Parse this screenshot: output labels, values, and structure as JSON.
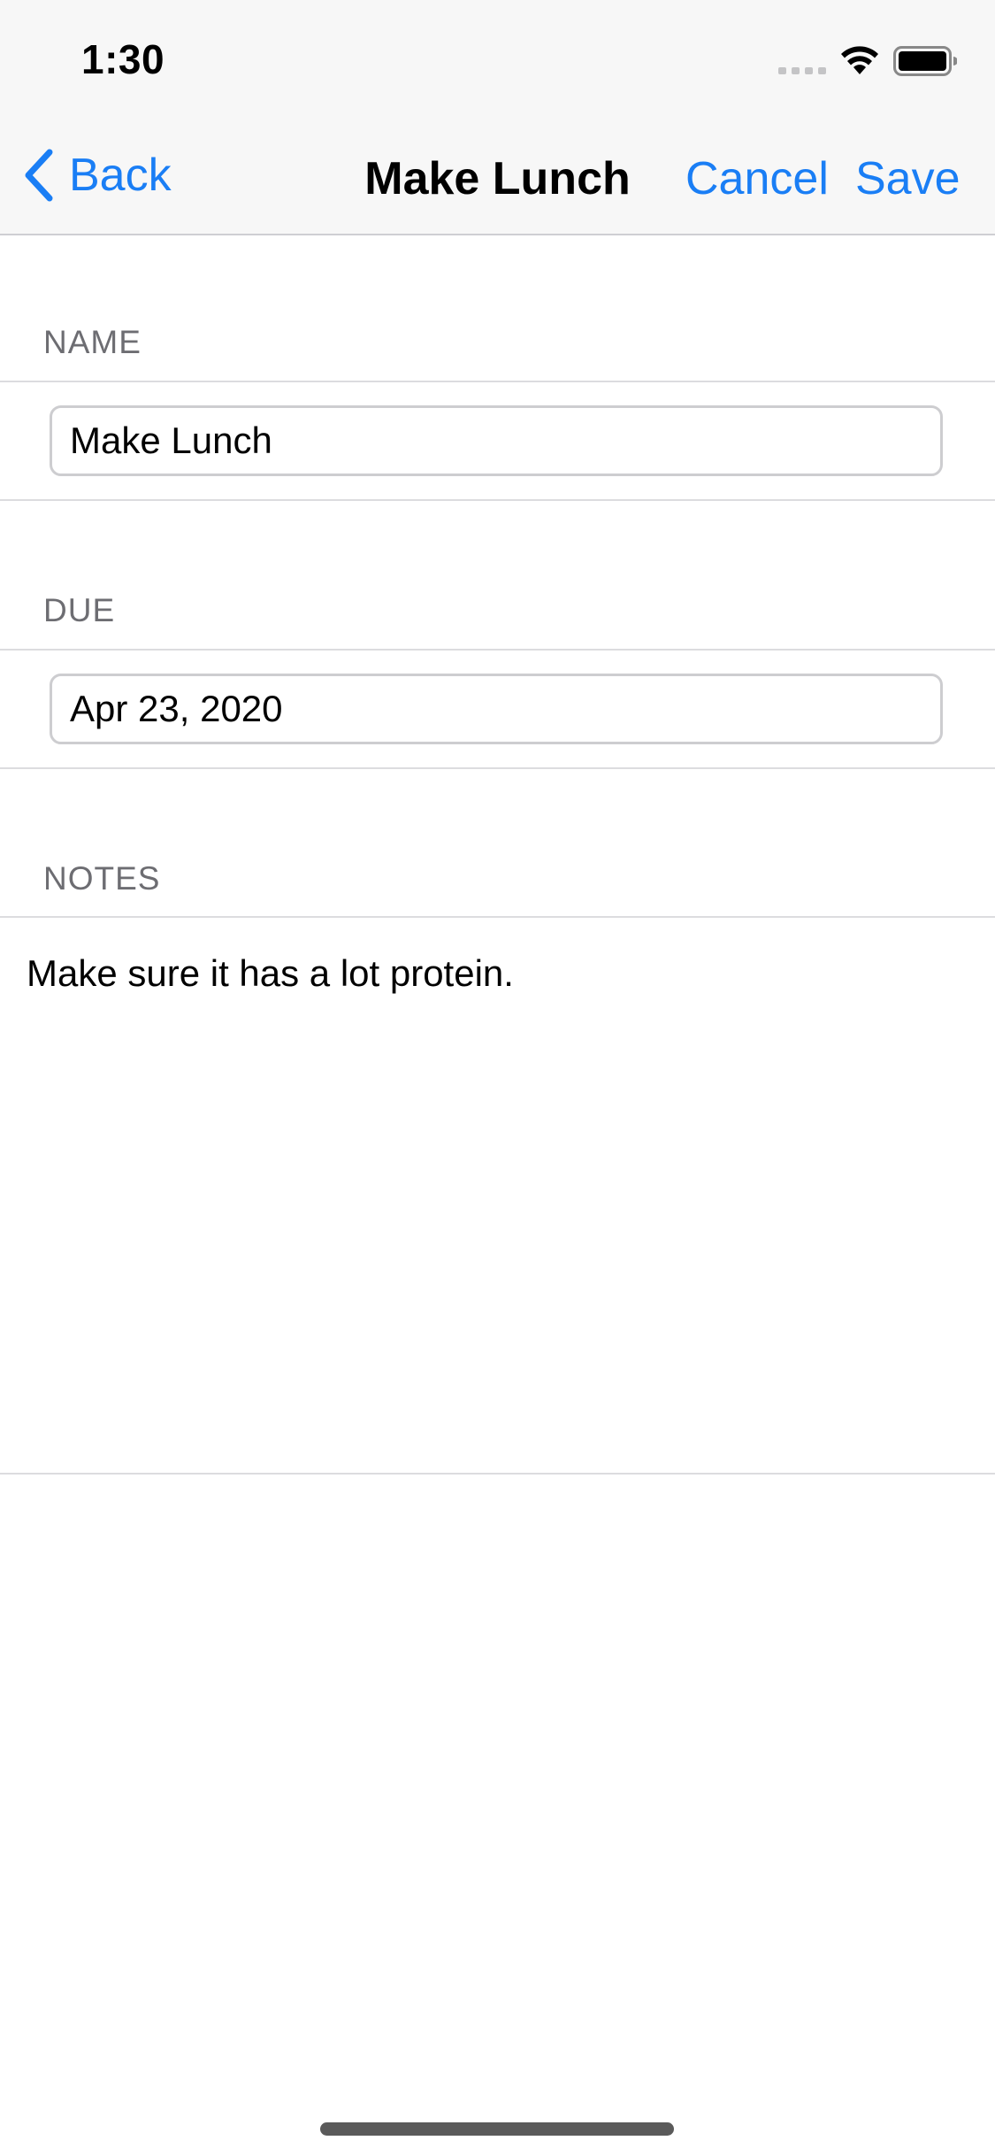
{
  "status_bar": {
    "time": "1:30",
    "icons": [
      "cellular-signal-icon",
      "wifi-icon",
      "battery-icon"
    ]
  },
  "nav": {
    "back_label": "Back",
    "title": "Make Lunch",
    "cancel_label": "Cancel",
    "save_label": "Save",
    "accent_color": "#1a7ef5"
  },
  "form": {
    "name": {
      "header": "NAME",
      "value": "Make Lunch"
    },
    "due": {
      "header": "DUE",
      "value": "Apr 23, 2020"
    },
    "notes": {
      "header": "NOTES",
      "value": "Make sure it has a lot protein."
    }
  }
}
